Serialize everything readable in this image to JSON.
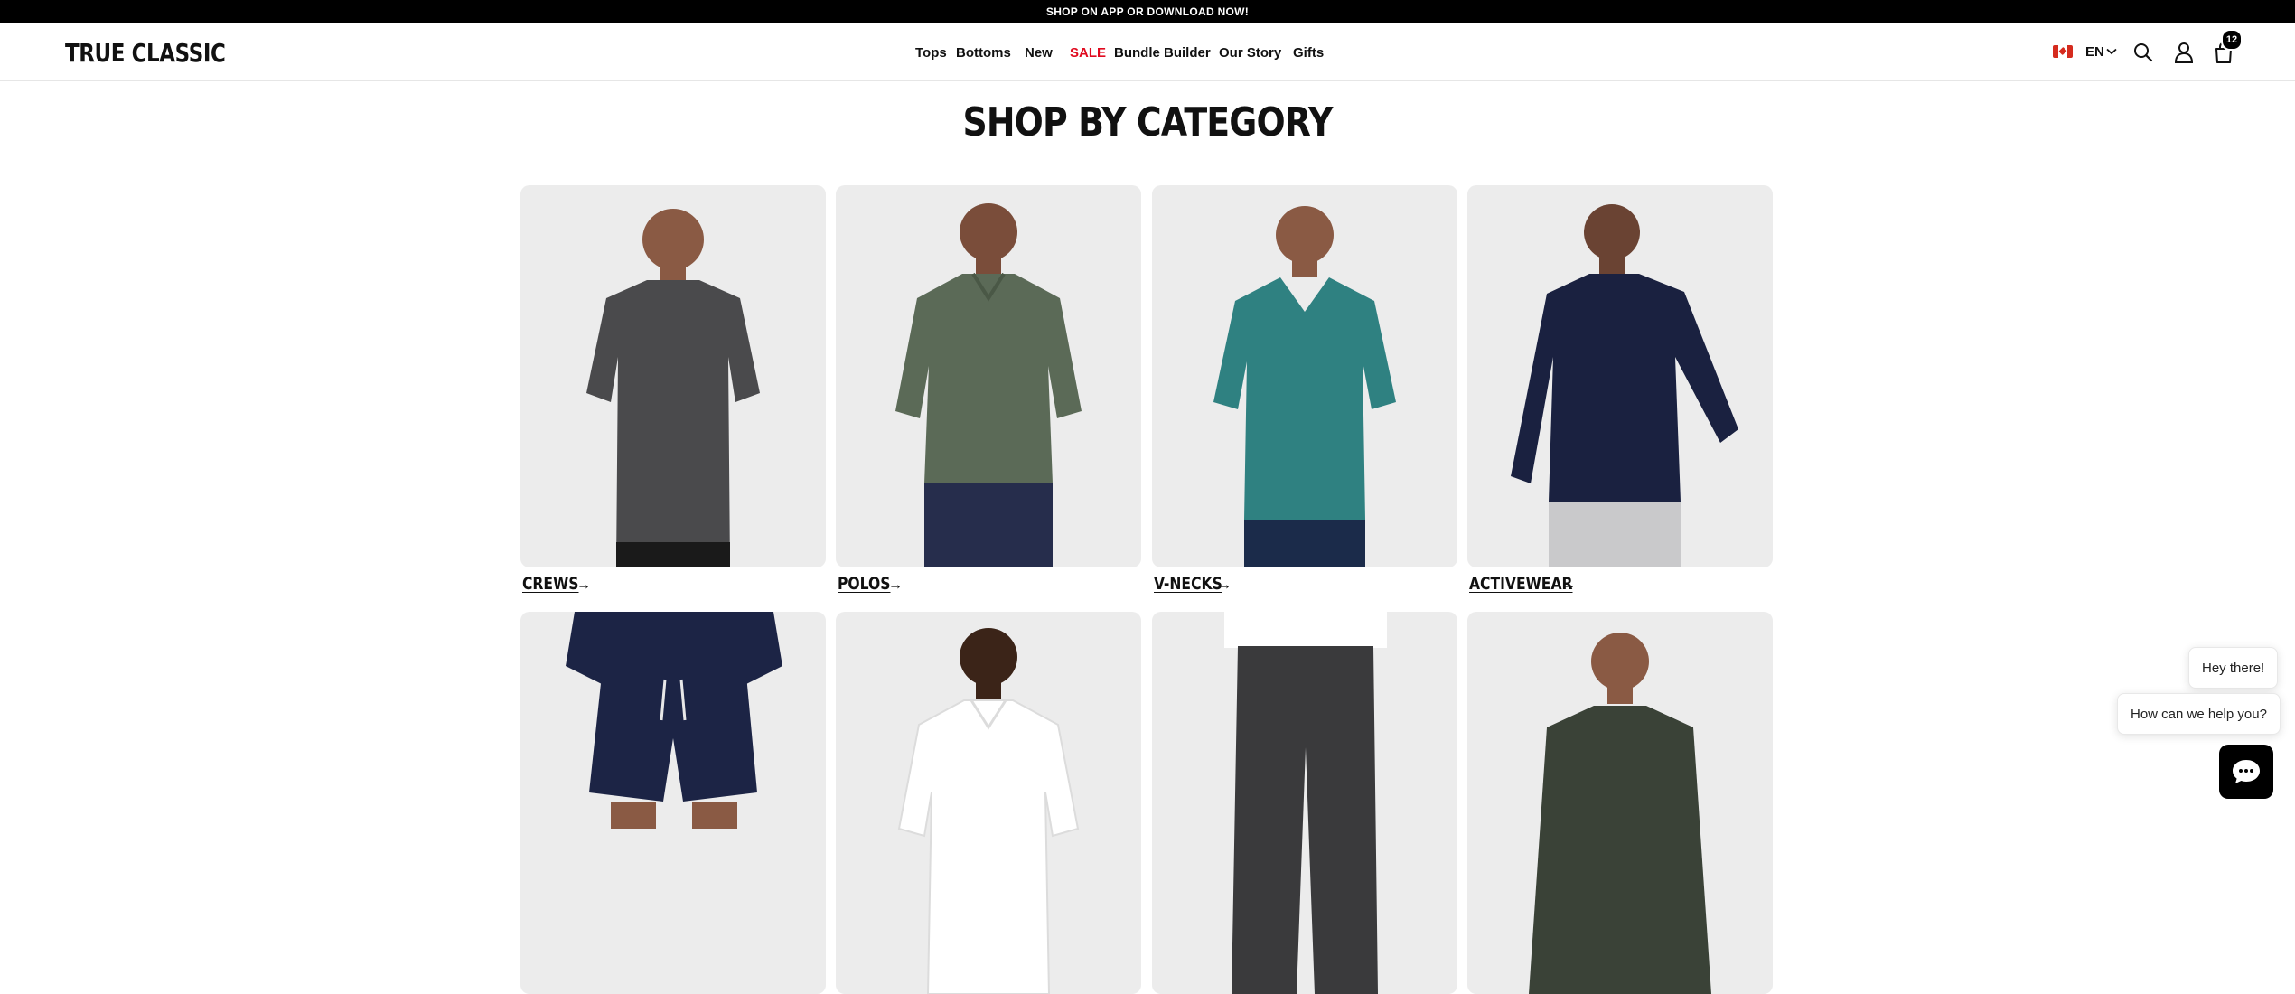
{
  "promo": {
    "text": "SHOP ON APP OR DOWNLOAD NOW!"
  },
  "brand": {
    "logo": "TRUE CLASSIC"
  },
  "nav": {
    "items": [
      {
        "label": "Tops"
      },
      {
        "label": "Bottoms"
      },
      {
        "label": "New"
      },
      {
        "label": "SALE",
        "color": "#e00a1f"
      },
      {
        "label": "Bundle Builder"
      },
      {
        "label": "Our Story"
      },
      {
        "label": "Gifts"
      }
    ]
  },
  "header_tools": {
    "country_flag": "canada-flag-icon",
    "language": "EN",
    "icons": [
      "search-icon",
      "account-icon",
      "cart-icon"
    ],
    "cart_count": "12"
  },
  "section": {
    "title": "SHOP BY CATEGORY"
  },
  "categories": [
    {
      "label": "CREWS",
      "arrow": "→",
      "shirt_color": "#4a4a4c",
      "bottom_color": "#1a1a1a"
    },
    {
      "label": "POLOS",
      "arrow": "→",
      "shirt_color": "#5b6a57",
      "bottom_color": "#262d4c"
    },
    {
      "label": "V-NECKS",
      "arrow": "→",
      "shirt_color": "#2f8181",
      "bottom_color": "#1b2b4a"
    },
    {
      "label": "ACTIVEWEAR",
      "arrow": "→",
      "shirt_color": "#1a2140",
      "bottom_color": "#c9c9cb"
    },
    {
      "label": "",
      "shirt_color": "#1c2445",
      "bottom_color": "#1c2445"
    },
    {
      "label": "",
      "shirt_color": "#ffffff",
      "bottom_color": "#ffffff"
    },
    {
      "label": "",
      "shirt_color": "#ffffff",
      "bottom_color": "#3a3a3c"
    },
    {
      "label": "",
      "shirt_color": "#3a4237",
      "bottom_color": "#3a4237"
    }
  ],
  "chat": {
    "greeting": "Hey there!",
    "prompt": "How can we help you?",
    "launcher_icon": "chat-bubble-icon"
  }
}
